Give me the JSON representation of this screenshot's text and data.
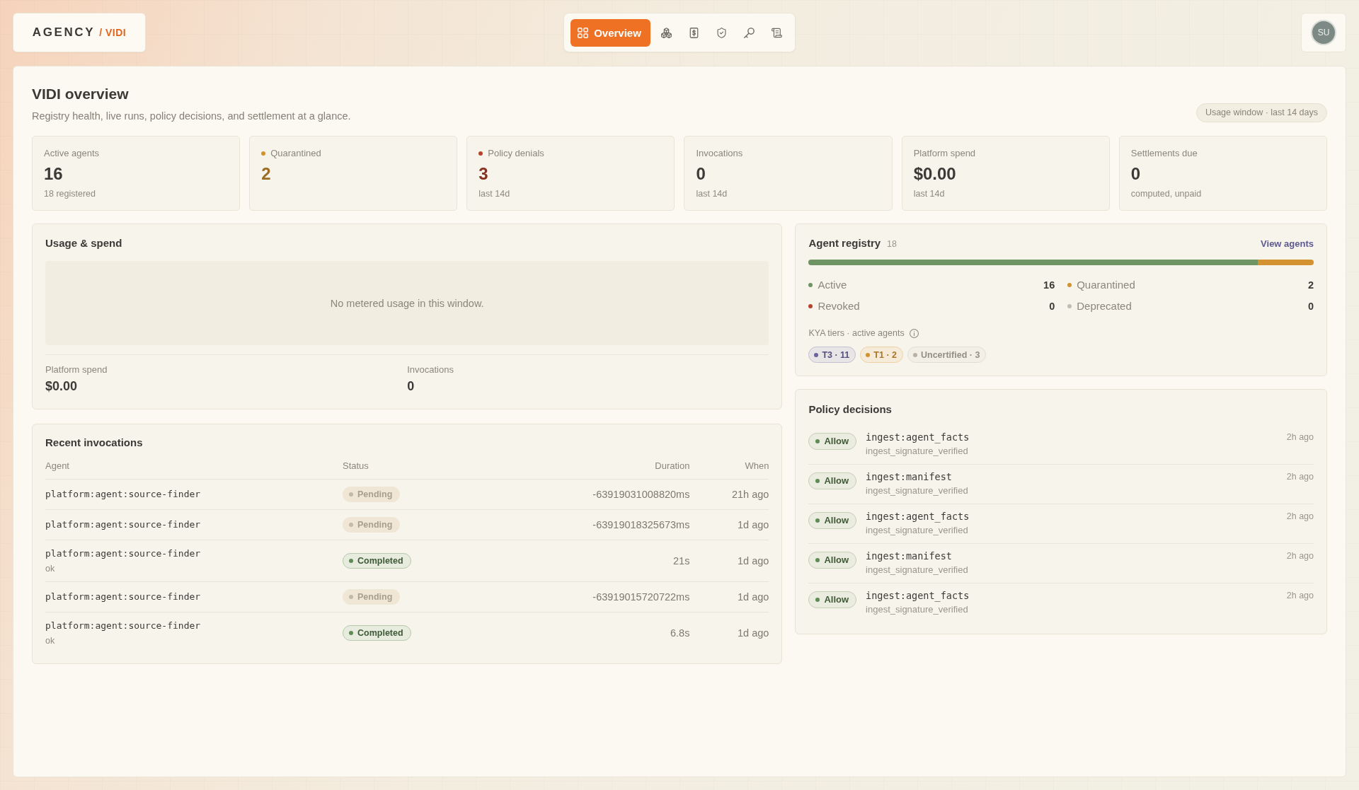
{
  "brand": {
    "name": "AGENCY",
    "product": "/ VIDI"
  },
  "nav": [
    {
      "kind": "grid",
      "label": "Overview",
      "selected": true
    },
    {
      "kind": "cubes",
      "selected": false
    },
    {
      "kind": "receipt",
      "selected": false
    },
    {
      "kind": "shield",
      "selected": false
    },
    {
      "kind": "key",
      "selected": false
    },
    {
      "kind": "scroll",
      "selected": false
    }
  ],
  "user": {
    "initials": "SU"
  },
  "page": {
    "title": "VIDI overview",
    "subtitle": "Registry health, live runs, policy decisions, and settlement at a glance.",
    "window_badge": "Usage window · last 14 days"
  },
  "stats": [
    {
      "label": "Active agents",
      "value": "16",
      "note": "18 registered"
    },
    {
      "label": "Quarantined",
      "value": "2",
      "color": "#d3922f"
    },
    {
      "label": "Policy denials",
      "value": "3",
      "note": "last 14d",
      "color": "#b8432d"
    },
    {
      "label": "Invocations",
      "value": "0",
      "note": "last 14d"
    },
    {
      "label": "Platform spend",
      "value": "$0.00",
      "note": "last 14d"
    },
    {
      "label": "Settlements due",
      "value": "0",
      "note": "computed, unpaid"
    }
  ],
  "usage": {
    "title": "Usage & spend",
    "empty_message": "No metered usage in this window.",
    "metrics": [
      {
        "label": "Platform spend",
        "value": "$0.00"
      },
      {
        "label": "Invocations",
        "value": "0"
      }
    ]
  },
  "invocations": {
    "title": "Recent invocations",
    "columns": [
      "Agent",
      "Status",
      "Duration",
      "When"
    ],
    "rows": [
      {
        "agent": "platform:agent:source-finder",
        "status": {
          "label": "Pending",
          "kind": "pending"
        },
        "duration": "-63919031008820ms",
        "when": "21h ago"
      },
      {
        "agent": "platform:agent:source-finder",
        "status": {
          "label": "Pending",
          "kind": "pending"
        },
        "duration": "-63919018325673ms",
        "when": "1d ago"
      },
      {
        "agent": "platform:agent:source-finder",
        "note": "ok",
        "status": {
          "label": "Completed",
          "kind": "completed"
        },
        "duration": "21s",
        "when": "1d ago"
      },
      {
        "agent": "platform:agent:source-finder",
        "status": {
          "label": "Pending",
          "kind": "pending"
        },
        "duration": "-63919015720722ms",
        "when": "1d ago"
      },
      {
        "agent": "platform:agent:source-finder",
        "note": "ok",
        "status": {
          "label": "Completed",
          "kind": "completed"
        },
        "duration": "6.8s",
        "when": "1d ago"
      }
    ]
  },
  "registry": {
    "title": "Agent registry",
    "count": "18",
    "link": "View agents",
    "legend": [
      {
        "label": "Active",
        "count": "16",
        "color": "#6d9462",
        "level": 0.889
      },
      {
        "label": "Quarantined",
        "count": "2",
        "color": "#d3922f",
        "level": 0.111
      },
      {
        "label": "Revoked",
        "count": "0",
        "color": "#b8432d"
      },
      {
        "label": "Deprecated",
        "count": "0",
        "color": "#c2bdb2"
      }
    ],
    "tiers_label": "KYA tiers · active agents",
    "tiers": [
      {
        "label": "T3 · 11",
        "color": "#6a639e"
      },
      {
        "label": "T1 · 2",
        "color": "#d3922f"
      },
      {
        "label": "Uncertified · 3",
        "color": "#b9b2a4"
      }
    ]
  },
  "policy": {
    "title": "Policy decisions",
    "rows": [
      {
        "decision": {
          "label": "Allow",
          "kind": "allow"
        },
        "action": "ingest:agent_facts",
        "reason": "ingest_signature_verified",
        "when": "2h ago"
      },
      {
        "decision": {
          "label": "Allow",
          "kind": "allow"
        },
        "action": "ingest:manifest",
        "reason": "ingest_signature_verified",
        "when": "2h ago"
      },
      {
        "decision": {
          "label": "Allow",
          "kind": "allow"
        },
        "action": "ingest:agent_facts",
        "reason": "ingest_signature_verified",
        "when": "2h ago"
      },
      {
        "decision": {
          "label": "Allow",
          "kind": "allow"
        },
        "action": "ingest:manifest",
        "reason": "ingest_signature_verified",
        "when": "2h ago"
      },
      {
        "decision": {
          "label": "Allow",
          "kind": "allow"
        },
        "action": "ingest:agent_facts",
        "reason": "ingest_signature_verified",
        "when": "2h ago"
      }
    ]
  }
}
